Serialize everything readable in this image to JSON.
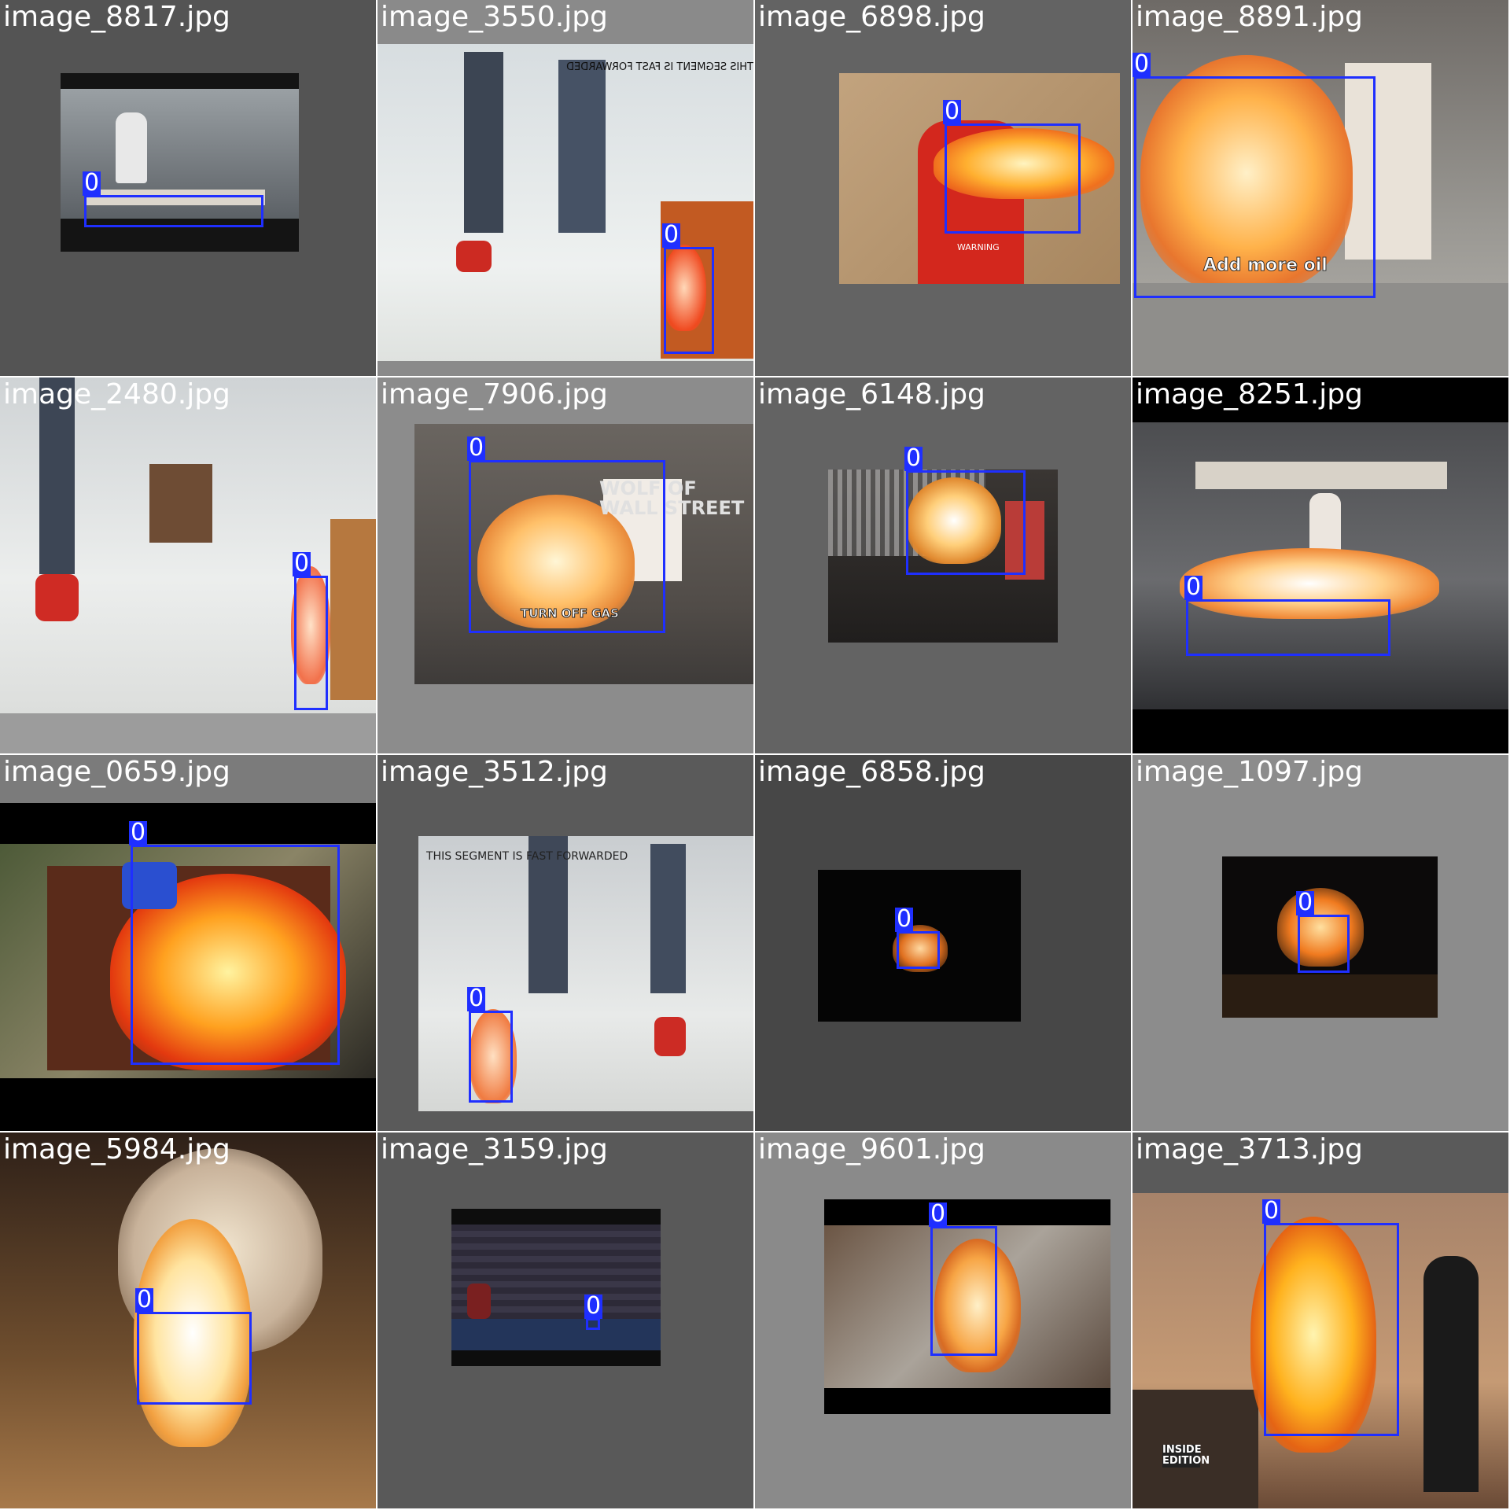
{
  "grid_title": "",
  "box_class_label": "0",
  "colors": {
    "box": "#1f2fff",
    "label_text": "#ffffff"
  },
  "tiles": [
    {
      "filename": "image_8817.jpg"
    },
    {
      "filename": "image_3550.jpg"
    },
    {
      "filename": "image_6898.jpg"
    },
    {
      "filename": "image_8891.jpg"
    },
    {
      "filename": "image_2480.jpg"
    },
    {
      "filename": "image_7906.jpg"
    },
    {
      "filename": "image_6148.jpg"
    },
    {
      "filename": "image_8251.jpg"
    },
    {
      "filename": "image_0659.jpg"
    },
    {
      "filename": "image_3512.jpg"
    },
    {
      "filename": "image_6858.jpg"
    },
    {
      "filename": "image_1097.jpg"
    },
    {
      "filename": "image_5984.jpg"
    },
    {
      "filename": "image_3159.jpg"
    },
    {
      "filename": "image_9601.jpg"
    },
    {
      "filename": "image_3713.jpg"
    }
  ],
  "overlay_text": {
    "t1": "THIS SEGMENT IS FAST FORWARDED",
    "t3": "Add more oil",
    "t5": "TURN OFF GAS",
    "t9": "THIS SEGMENT IS FAST FORWARDED",
    "t15": "INSIDE EDITION",
    "t2": "WARNING",
    "t3b": "WOLF OF WALL STREET",
    "t5b": "WOLF OF STREET"
  }
}
